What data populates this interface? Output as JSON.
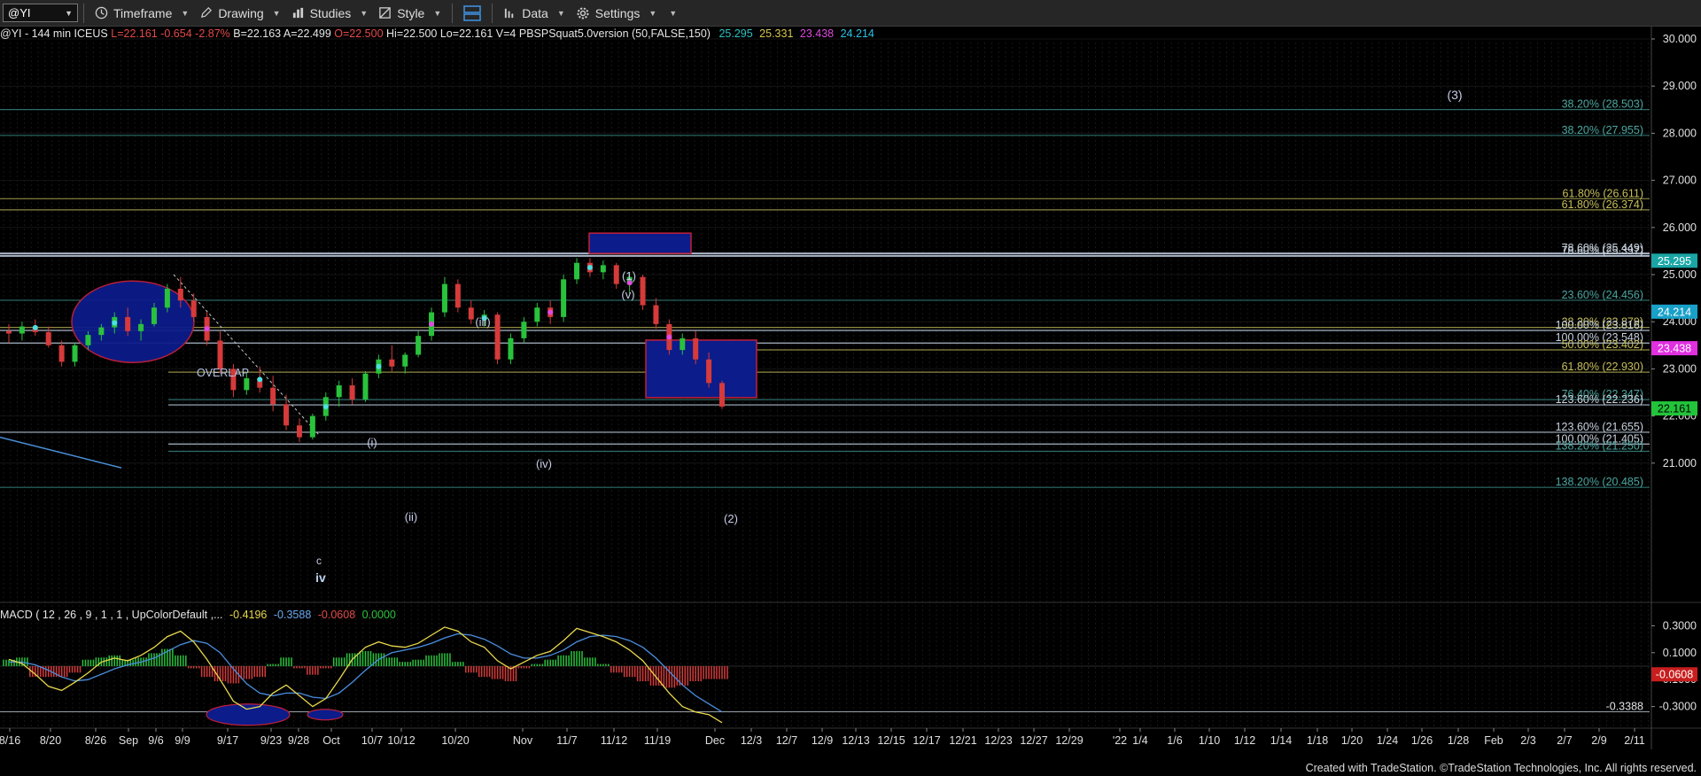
{
  "toolbar": {
    "symbol": "@YI",
    "timeframe_label": "Timeframe",
    "drawing_label": "Drawing",
    "studies_label": "Studies",
    "style_label": "Style",
    "data_label": "Data",
    "settings_label": "Settings"
  },
  "status": {
    "symbol_info": "@YI - 144 min  ICEUS",
    "last": "L=22.161",
    "change": "-0.654",
    "pct": "-2.87%",
    "bid": "B=22.163",
    "ask": "A=22.499",
    "open": "O=22.500",
    "high": "Hi=22.500",
    "low": "Lo=22.161",
    "volume": "V=4",
    "study": "PBSPSquat5.0version (50,FALSE,150)",
    "v1": "25.295",
    "v2": "25.331",
    "v3": "23.438",
    "v4": "24.214"
  },
  "macd_status": {
    "label": "MACD ( 12 , 26 , 9 , 1 , 1 , UpColorDefault ,...",
    "v1": "-0.4196",
    "v2": "-0.3588",
    "v3": "-0.0608",
    "v4": "0.0000"
  },
  "colors": {
    "bull": "#29c23c",
    "bear": "#d63a3a",
    "macd_line": "#e8d84c",
    "signal_line": "#4a8ee0",
    "fib_teal": "#2e6e6a",
    "fib_olive": "#8d8a42",
    "fib_white": "#a9b6c7",
    "box_fill": "#0c1c8a",
    "box_stroke": "#c0203a"
  },
  "chart_data": {
    "type": "candlestick",
    "price_axis": {
      "ticks": [
        "30.000",
        "29.000",
        "28.000",
        "27.000",
        "26.000",
        "25.000",
        "24.000",
        "23.000",
        "22.000",
        "21.000"
      ],
      "range": [
        20.25,
        30.3
      ]
    },
    "price_flags": [
      {
        "label": "25.295",
        "value": 25.295,
        "color": "#1aa6a6",
        "text_color": "#fff"
      },
      {
        "label": "24.214",
        "value": 24.214,
        "color": "#18a0c8",
        "text_color": "#fff"
      },
      {
        "label": "23.438",
        "value": 23.438,
        "color": "#e030e0",
        "text_color": "#fff"
      },
      {
        "label": "22.161",
        "value": 22.161,
        "color": "#22c43a",
        "text_color": "#000"
      }
    ],
    "fib_levels": [
      {
        "label": "38.20% (28.503)",
        "value": 28.503,
        "color": "teal"
      },
      {
        "label": "38.20% (27.955)",
        "value": 27.955,
        "color": "teal"
      },
      {
        "label": "61.80% (26.611)",
        "value": 26.611,
        "color": "olive"
      },
      {
        "label": "61.80% (26.374)",
        "value": 26.374,
        "color": "olive"
      },
      {
        "label": "78.60% (25.449)",
        "value": 25.449,
        "color": "white"
      },
      {
        "label": "78.60% (25.397)",
        "value": 25.397,
        "color": "white"
      },
      {
        "label": "23.60% (24.456)",
        "value": 24.456,
        "color": "teal"
      },
      {
        "label": "38.20% (23.879)",
        "value": 23.879,
        "color": "olive"
      },
      {
        "label": "100.00% (23.816)",
        "value": 23.816,
        "color": "white"
      },
      {
        "label": "100.00% (23.548)",
        "value": 23.548,
        "color": "white"
      },
      {
        "label": "50.00% (23.402)",
        "value": 23.402,
        "color": "olive"
      },
      {
        "label": "61.80% (22.930)",
        "value": 22.93,
        "color": "olive"
      },
      {
        "label": "76.40% (22.347)",
        "value": 22.347,
        "color": "teal"
      },
      {
        "label": "123.60% (22.236)",
        "value": 22.236,
        "color": "white"
      },
      {
        "label": "123.60% (21.655)",
        "value": 21.655,
        "color": "white"
      },
      {
        "label": "100.00% (21.405)",
        "value": 21.405,
        "color": "white"
      },
      {
        "label": "138.20% (21.250)",
        "value": 21.25,
        "color": "teal"
      },
      {
        "label": "138.20% (20.485)",
        "value": 20.485,
        "color": "teal"
      }
    ],
    "wave_labels": [
      "(3)",
      "(1)",
      "(v)",
      "(iii)",
      "(i)",
      "(ii)",
      "(iv)",
      "(2)",
      "c",
      "iv",
      "OVERLAP"
    ],
    "x_axis_labels": [
      "8/16",
      "8/20",
      "8/26",
      "Sep",
      "9/6",
      "9/9",
      "9/17",
      "9/23",
      "9/28",
      "Oct",
      "10/7",
      "10/12",
      "10/20",
      "Nov",
      "11/7",
      "11/12",
      "11/19",
      "Dec",
      "12/3",
      "12/7",
      "12/9",
      "12/13",
      "12/15",
      "12/17",
      "12/21",
      "12/23",
      "12/27",
      "12/29",
      "'22",
      "1/4",
      "1/6",
      "1/10",
      "1/12",
      "1/14",
      "1/18",
      "1/20",
      "1/24",
      "1/26",
      "1/28",
      "Feb",
      "2/3",
      "2/7",
      "2/9",
      "2/11"
    ],
    "candles": [
      {
        "o": 23.8,
        "h": 23.95,
        "l": 23.55,
        "c": 23.75
      },
      {
        "o": 23.75,
        "h": 24.0,
        "l": 23.6,
        "c": 23.9
      },
      {
        "o": 23.9,
        "h": 24.05,
        "l": 23.7,
        "c": 23.78
      },
      {
        "o": 23.78,
        "h": 23.9,
        "l": 23.45,
        "c": 23.5
      },
      {
        "o": 23.5,
        "h": 23.6,
        "l": 23.05,
        "c": 23.15
      },
      {
        "o": 23.15,
        "h": 23.55,
        "l": 23.05,
        "c": 23.5
      },
      {
        "o": 23.5,
        "h": 23.8,
        "l": 23.4,
        "c": 23.72
      },
      {
        "o": 23.72,
        "h": 23.95,
        "l": 23.6,
        "c": 23.88
      },
      {
        "o": 23.88,
        "h": 24.2,
        "l": 23.75,
        "c": 24.1
      },
      {
        "o": 24.1,
        "h": 24.3,
        "l": 23.7,
        "c": 23.8
      },
      {
        "o": 23.8,
        "h": 24.05,
        "l": 23.6,
        "c": 23.95
      },
      {
        "o": 23.95,
        "h": 24.4,
        "l": 23.9,
        "c": 24.3
      },
      {
        "o": 24.3,
        "h": 24.8,
        "l": 24.2,
        "c": 24.7
      },
      {
        "o": 24.7,
        "h": 24.95,
        "l": 24.3,
        "c": 24.45
      },
      {
        "o": 24.45,
        "h": 24.6,
        "l": 24.0,
        "c": 24.1
      },
      {
        "o": 24.1,
        "h": 24.2,
        "l": 23.5,
        "c": 23.6
      },
      {
        "o": 23.6,
        "h": 23.8,
        "l": 22.9,
        "c": 23.0
      },
      {
        "o": 23.0,
        "h": 23.1,
        "l": 22.4,
        "c": 22.55
      },
      {
        "o": 22.55,
        "h": 22.9,
        "l": 22.45,
        "c": 22.8
      },
      {
        "o": 22.8,
        "h": 23.05,
        "l": 22.5,
        "c": 22.6
      },
      {
        "o": 22.6,
        "h": 22.85,
        "l": 22.1,
        "c": 22.25
      },
      {
        "o": 22.25,
        "h": 22.45,
        "l": 21.7,
        "c": 21.8
      },
      {
        "o": 21.8,
        "h": 21.95,
        "l": 21.45,
        "c": 21.55
      },
      {
        "o": 21.55,
        "h": 22.05,
        "l": 21.5,
        "c": 22.0
      },
      {
        "o": 22.0,
        "h": 22.5,
        "l": 21.9,
        "c": 22.4
      },
      {
        "o": 22.4,
        "h": 22.75,
        "l": 22.2,
        "c": 22.65
      },
      {
        "o": 22.65,
        "h": 22.8,
        "l": 22.25,
        "c": 22.35
      },
      {
        "o": 22.35,
        "h": 22.95,
        "l": 22.3,
        "c": 22.9
      },
      {
        "o": 22.9,
        "h": 23.3,
        "l": 22.8,
        "c": 23.2
      },
      {
        "o": 23.2,
        "h": 23.5,
        "l": 22.95,
        "c": 23.05
      },
      {
        "o": 23.05,
        "h": 23.35,
        "l": 22.9,
        "c": 23.3
      },
      {
        "o": 23.3,
        "h": 23.8,
        "l": 23.25,
        "c": 23.7
      },
      {
        "o": 23.7,
        "h": 24.3,
        "l": 23.6,
        "c": 24.2
      },
      {
        "o": 24.2,
        "h": 24.95,
        "l": 24.1,
        "c": 24.8
      },
      {
        "o": 24.8,
        "h": 24.9,
        "l": 24.2,
        "c": 24.3
      },
      {
        "o": 24.3,
        "h": 24.45,
        "l": 23.95,
        "c": 24.05
      },
      {
        "o": 24.05,
        "h": 24.25,
        "l": 23.9,
        "c": 24.15
      },
      {
        "o": 24.15,
        "h": 24.2,
        "l": 23.1,
        "c": 23.2
      },
      {
        "o": 23.2,
        "h": 23.75,
        "l": 23.1,
        "c": 23.65
      },
      {
        "o": 23.65,
        "h": 24.1,
        "l": 23.55,
        "c": 24.0
      },
      {
        "o": 24.0,
        "h": 24.4,
        "l": 23.9,
        "c": 24.3
      },
      {
        "o": 24.3,
        "h": 24.45,
        "l": 23.95,
        "c": 24.1
      },
      {
        "o": 24.1,
        "h": 25.0,
        "l": 24.0,
        "c": 24.9
      },
      {
        "o": 24.9,
        "h": 25.35,
        "l": 24.8,
        "c": 25.25
      },
      {
        "o": 25.25,
        "h": 25.35,
        "l": 24.95,
        "c": 25.05
      },
      {
        "o": 25.05,
        "h": 25.3,
        "l": 24.9,
        "c": 25.2
      },
      {
        "o": 25.2,
        "h": 25.25,
        "l": 24.7,
        "c": 24.8
      },
      {
        "o": 24.8,
        "h": 25.05,
        "l": 24.6,
        "c": 24.95
      },
      {
        "o": 24.95,
        "h": 25.0,
        "l": 24.25,
        "c": 24.35
      },
      {
        "o": 24.35,
        "h": 24.5,
        "l": 23.85,
        "c": 23.95
      },
      {
        "o": 23.95,
        "h": 24.05,
        "l": 23.3,
        "c": 23.4
      },
      {
        "o": 23.4,
        "h": 23.75,
        "l": 23.3,
        "c": 23.65
      },
      {
        "o": 23.65,
        "h": 23.8,
        "l": 23.1,
        "c": 23.2
      },
      {
        "o": 23.2,
        "h": 23.35,
        "l": 22.6,
        "c": 22.7
      },
      {
        "o": 22.7,
        "h": 22.75,
        "l": 22.15,
        "c": 22.2
      }
    ],
    "macd_axis": {
      "ticks": [
        "0.3000",
        "0.1000",
        "-0.1000",
        "-0.3000"
      ],
      "range": [
        -0.42,
        0.42
      ]
    },
    "macd_flags": [
      {
        "label": "-0.0608",
        "value": -0.0608,
        "color": "#c81e1e"
      }
    ],
    "macd_levels": [
      {
        "label": "-0.3388",
        "value": -0.3388
      }
    ],
    "macd": [
      0.05,
      0.02,
      -0.06,
      -0.15,
      -0.18,
      -0.12,
      -0.05,
      0.03,
      0.06,
      0.04,
      0.08,
      0.14,
      0.22,
      0.26,
      0.18,
      0.05,
      -0.1,
      -0.26,
      -0.32,
      -0.3,
      -0.2,
      -0.14,
      -0.22,
      -0.3,
      -0.24,
      -0.1,
      0.05,
      0.14,
      0.18,
      0.15,
      0.14,
      0.17,
      0.23,
      0.29,
      0.26,
      0.18,
      0.14,
      0.04,
      -0.02,
      0.03,
      0.08,
      0.11,
      0.19,
      0.28,
      0.25,
      0.22,
      0.18,
      0.12,
      0.04,
      -0.08,
      -0.2,
      -0.3,
      -0.34,
      -0.36,
      -0.42
    ],
    "signal": [
      0.03,
      0.03,
      0.01,
      -0.03,
      -0.08,
      -0.11,
      -0.1,
      -0.06,
      -0.02,
      0.01,
      0.03,
      0.06,
      0.11,
      0.16,
      0.19,
      0.17,
      0.1,
      -0.02,
      -0.13,
      -0.2,
      -0.22,
      -0.2,
      -0.2,
      -0.23,
      -0.24,
      -0.2,
      -0.12,
      -0.03,
      0.05,
      0.1,
      0.12,
      0.14,
      0.17,
      0.21,
      0.24,
      0.23,
      0.2,
      0.15,
      0.09,
      0.06,
      0.06,
      0.08,
      0.12,
      0.18,
      0.22,
      0.23,
      0.22,
      0.19,
      0.14,
      0.06,
      -0.04,
      -0.14,
      -0.22,
      -0.28,
      -0.34
    ],
    "histogram": [
      0.03,
      0.04,
      -0.05,
      -0.05,
      -0.05,
      -0.03,
      0.03,
      0.04,
      0.05,
      0.03,
      0.04,
      0.06,
      0.08,
      0.05,
      -0.01,
      -0.05,
      -0.07,
      -0.08,
      -0.06,
      -0.05,
      0.01,
      0.04,
      -0.01,
      -0.04,
      -0.01,
      0.04,
      0.06,
      0.07,
      0.06,
      0.04,
      0.02,
      0.03,
      0.05,
      0.06,
      0.02,
      -0.03,
      -0.05,
      -0.06,
      -0.07,
      -0.01,
      0.01,
      0.03,
      0.05,
      0.07,
      0.04,
      0.01,
      -0.03,
      -0.05,
      -0.07,
      -0.09,
      -0.1,
      -0.09,
      -0.07,
      -0.06,
      -0.06
    ]
  },
  "footer": {
    "credit": "Created with TradeStation. ©TradeStation Technologies, Inc. All rights reserved."
  }
}
